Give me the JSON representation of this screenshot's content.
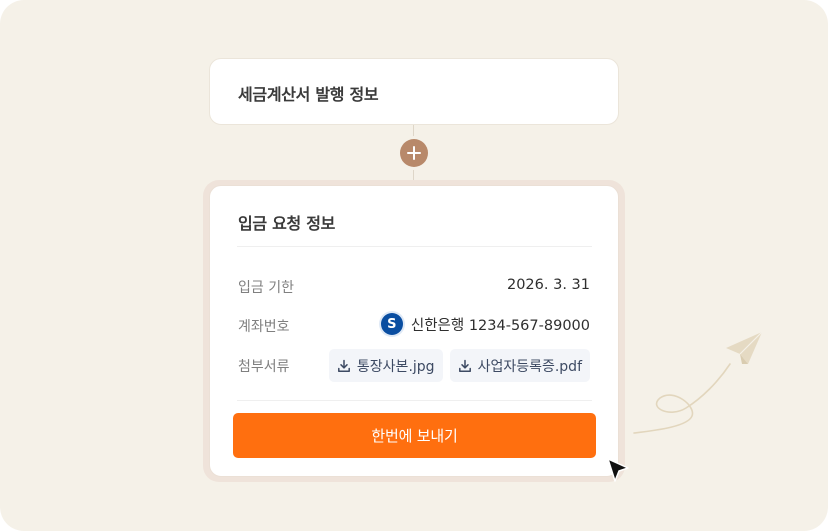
{
  "tax_card": {
    "title": "세금계산서 발행 정보"
  },
  "add_icon": "plus-icon",
  "payment_card": {
    "title": "입금 요청 정보",
    "rows": [
      {
        "label": "입금 기한",
        "value": "2026. 3. 31"
      },
      {
        "label": "계좌번호",
        "bank_icon": "shinhan-bank-logo",
        "value": "신한은행 1234-567-89000"
      },
      {
        "label": "첨부서류"
      }
    ],
    "attachments": [
      {
        "icon": "download-icon",
        "name": "통장사본.jpg"
      },
      {
        "icon": "download-icon",
        "name": "사업자등록증.pdf"
      }
    ],
    "send_button": "한번에 보내기"
  },
  "colors": {
    "background": "#f5f1e8",
    "accent": "#ff6f0f",
    "plus_button": "#b8896a",
    "bank_brand": "#0a4ea1"
  }
}
